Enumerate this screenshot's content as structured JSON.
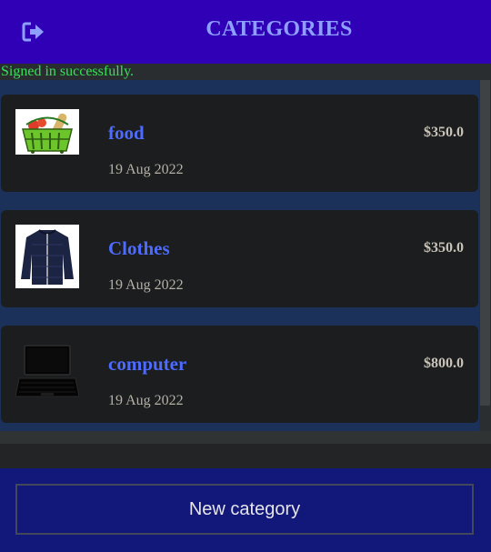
{
  "header": {
    "title": "CATEGORIES",
    "logout_icon": "sign-out-icon"
  },
  "notice": "Signed in successfully.",
  "categories": [
    {
      "name": "food",
      "date": "19 Aug 2022",
      "amount": "$350.0",
      "icon": "grocery-basket-icon"
    },
    {
      "name": "Clothes",
      "date": "19 Aug 2022",
      "amount": "$350.0",
      "icon": "jacket-icon"
    },
    {
      "name": "computer",
      "date": "19 Aug 2022",
      "amount": "$800.0",
      "icon": "laptop-icon"
    }
  ],
  "footer": {
    "new_category_label": "New category"
  },
  "colors": {
    "header": "#3000b6",
    "link": "#4d6bff",
    "notice": "#37e05a",
    "footer": "#12177a"
  }
}
